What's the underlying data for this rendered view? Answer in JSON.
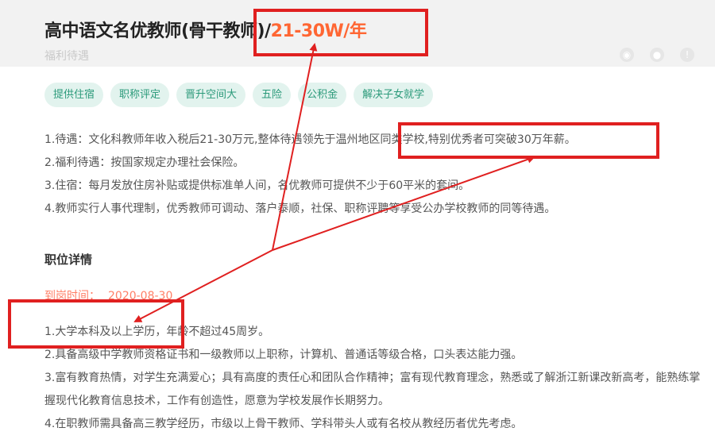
{
  "job": {
    "title_main": "高中语文名优教师(骨干教师)/",
    "salary": "21-30W/年",
    "welfare_label": "福利待遇"
  },
  "icons": [
    "collect-icon",
    "wechat-icon",
    "info-icon"
  ],
  "tags": [
    "提供住宿",
    "职称评定",
    "晋升空间大",
    "五险",
    "公积金",
    "解决子女就学"
  ],
  "benefits": [
    "1.待遇：文化科教师年收入税后21-30万元,整体待遇领先于温州地区同类学校,特别优秀者可突破30万年薪。",
    "2.福利待遇：按国家规定办理社会保险。",
    "3.住宿：每月发放住房补贴或提供标准单人间，名优教师可提供不少于60平米的套间。",
    "4.教师实行人事代理制，优秀教师可调动、落户泰顺，社保、职称评聘等享受公办学校教师的同等待遇。"
  ],
  "section_title": "职位详情",
  "arrival": {
    "label": "到岗时间：",
    "value": "2020-08-30"
  },
  "requirements": [
    "1.大学本科及以上学历，年龄不超过45周岁。",
    "2.具备高级中学教师资格证书和一级教师以上职称，计算机、普通话等级合格，口头表达能力强。",
    "3.富有教育热情，对学生充满爱心；具有高度的责任心和团队合作精神；富有现代教育理念，熟悉或了解浙江新课改新高考，能熟练掌握现代化教育信息技术，工作有创造性，愿意为学校发展作长期努力。",
    "4.在职教师需具备高三教学经历，市级以上骨干教师、学科带头人或有名校从教经历者优先考虑。"
  ],
  "colors": {
    "annotation": "#e02020",
    "salary": "#ff6633",
    "tag_bg": "#e2f3ee",
    "tag_text": "#2b9a7a",
    "arrival": "#ff7f66"
  }
}
